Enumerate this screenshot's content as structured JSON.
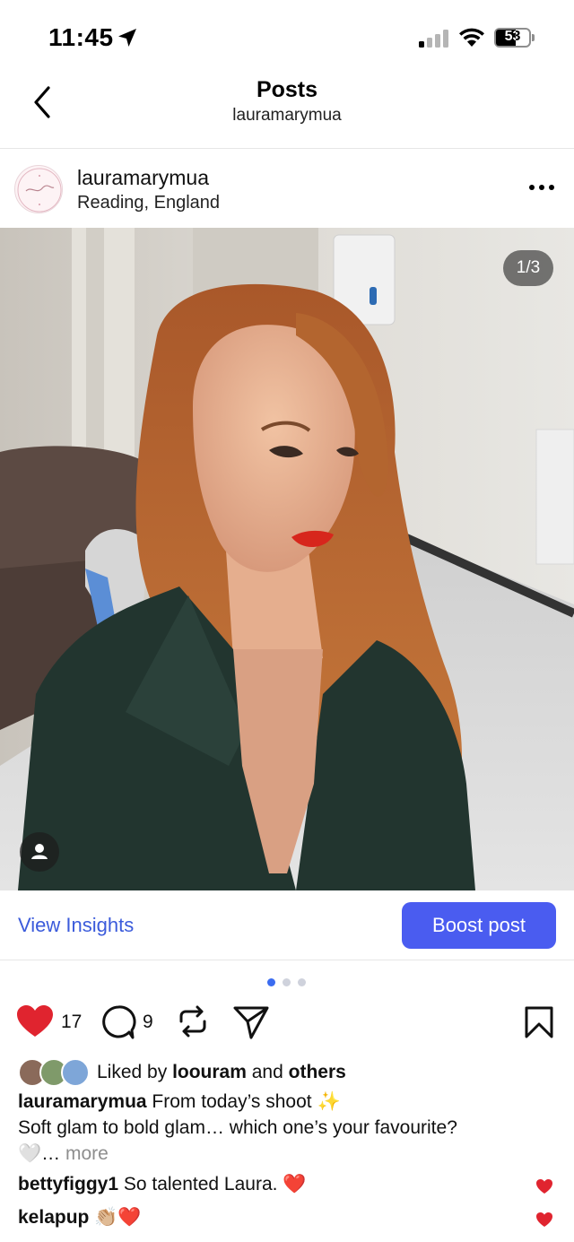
{
  "status_bar": {
    "time": "11:45",
    "battery": "53"
  },
  "header": {
    "title": "Posts",
    "subtitle": "lauramarymua"
  },
  "post": {
    "username": "lauramarymua",
    "location": "Reading, England",
    "counter": "1/3",
    "carousel_pages": 3,
    "carousel_current": 1
  },
  "insights": {
    "view_label": "View Insights",
    "boost_label": "Boost post"
  },
  "actions": {
    "likes_count": "17",
    "comments_count": "9"
  },
  "likes": {
    "prefix": "Liked by ",
    "user": "loouram",
    "middle": " and ",
    "others": "others"
  },
  "caption": {
    "username": "lauramarymua",
    "line1": " From today’s shoot ✨",
    "line2": "Soft glam to bold glam… which one’s your favourite?",
    "line3": "🤍… ",
    "more": "more"
  },
  "comments": [
    {
      "user": "bettyfiggy1",
      "text": " So talented Laura. ❤️"
    },
    {
      "user": "kelapup",
      "text": " 👏🏼❤️"
    }
  ],
  "colors": {
    "accent": "#4a5cf0",
    "link": "#3b5bdb",
    "like": "#e0242f"
  }
}
